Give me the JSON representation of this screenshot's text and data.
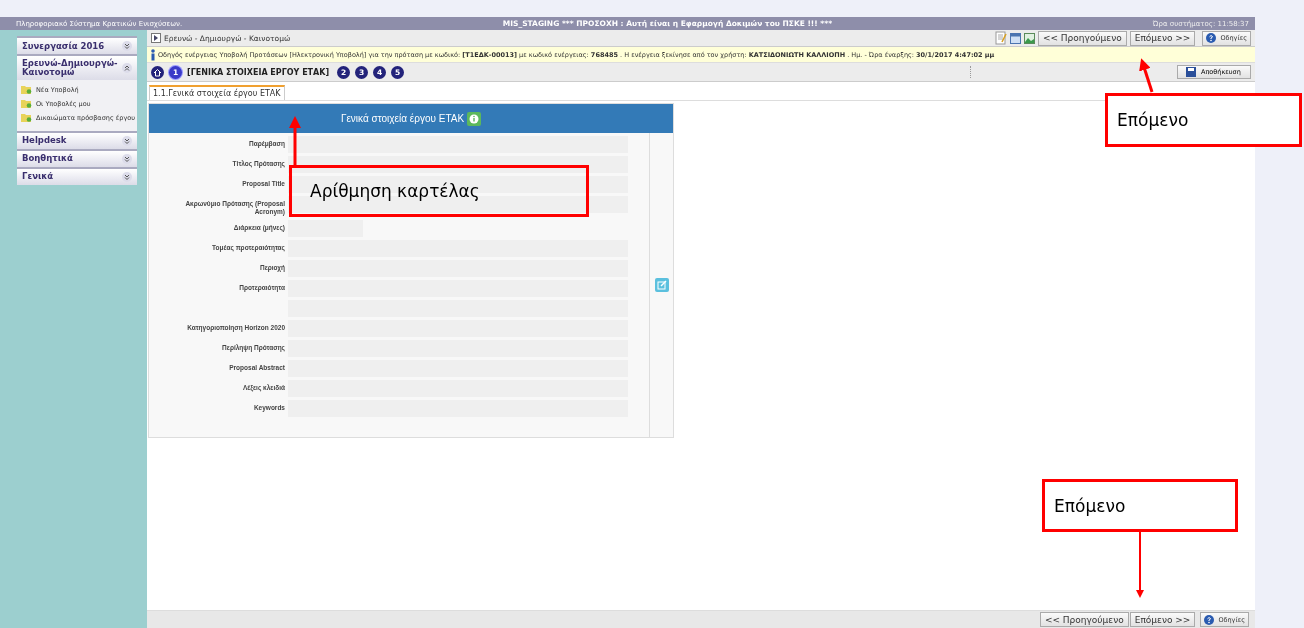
{
  "header": {
    "system": "Πληροφοριακό Σύστημα Κρατικών Ενισχύσεων.",
    "warning": "MIS_STAGING *** ΠΡΟΣΟΧΗ : Αυτή είναι η Εφαρμογή Δοκιμών του ΠΣΚΕ !!! ***",
    "clock": "Ώρα συστήματος: 11:58:37"
  },
  "sidebar": {
    "sections": [
      {
        "title": "Συνεργασία 2016",
        "expanded": false
      },
      {
        "title": "Ερευνώ-Δημιουργώ-Καινοτομώ",
        "expanded": true,
        "items": [
          "Νέα Υποβολή",
          "Οι Υποβολές μου",
          "Δικαιώματα πρόσβασης έργου"
        ]
      },
      {
        "title": "Helpdesk",
        "expanded": false
      },
      {
        "title": "Βοηθητικά",
        "expanded": false
      },
      {
        "title": "Γενικά",
        "expanded": false
      }
    ]
  },
  "toolbar": {
    "breadcrumb": "Ερευνώ - Δημιουργώ - Καινοτομώ",
    "previous": "<< Προηγούμενο",
    "next": "Επόμενο >>",
    "help": "Οδηγίες"
  },
  "info": "Οδηγός ενέργειας Υποβολή Προτάσεων [Ηλεκτρονική Υποβολή] για την πρόταση με κωδικό: **[Τ1ΕΔΚ-00013]** με κωδικό ενέργειας: **768485** . Η ενέργεια ξεκίνησε από τον χρήστη: **ΚΑΤΣΙΔΟΝΙΩΤΗ ΚΑΛΛΙΟΠΗ** . Ημ. - Ώρα έναρξης: **30/1/2017 4:47:02 μμ**",
  "steps": [
    {
      "number": "1",
      "label": "[ΓΕΝΙΚΑ ΣΤΟΙΧΕΙΑ ΕΡΓΟΥ ΕΤΑΚ]",
      "selected": true
    },
    {
      "number": "2",
      "selected": false
    },
    {
      "number": "3",
      "selected": false
    },
    {
      "number": "4",
      "selected": false
    },
    {
      "number": "5",
      "selected": false
    }
  ],
  "save": "Αποθήκευση",
  "tabs": [
    {
      "label": "1.1.Γενικά στοιχεία έργου ΕΤΑΚ",
      "selected": true
    }
  ],
  "panel": {
    "title": "Γενικά στοιχεία έργου ΕΤΑΚ",
    "fields": [
      {
        "label": "Παρέμβαση",
        "kind": "wide"
      },
      {
        "label": "Τίτλος Πρότασης",
        "kind": "wide"
      },
      {
        "label": "Proposal Title",
        "kind": "wide"
      },
      {
        "label": "Ακρωνύμιο Πρότασης (Proposal Acronym)",
        "kind": "wide"
      },
      {
        "label": "Διάρκεια (μήνες)",
        "kind": "short"
      },
      {
        "label": "Τομέας προτεραιότητας",
        "kind": "wide"
      },
      {
        "label": "Περιοχή",
        "kind": "wide"
      },
      {
        "label": "Προτεραιότητα",
        "kind": "wide"
      },
      {
        "kind": "wide"
      },
      {
        "label": "Κατηγοριοποίηση Horizon 2020",
        "kind": "wide"
      },
      {
        "label": "Περίληψη Πρότασης",
        "kind": "wide"
      },
      {
        "label": "Proposal Abstract",
        "kind": "wide"
      },
      {
        "label": "Λέξεις κλειδιά",
        "kind": "wide"
      },
      {
        "label": "Keywords",
        "kind": "wide"
      }
    ]
  },
  "bottom_bar": {
    "previous": "<< Προηγούμενο",
    "next": "Επόμενο >>",
    "help": "Οδηγίες"
  },
  "annotations": [
    {
      "text": "Επόμενο"
    },
    {
      "text": "Αρίθμηση καρτέλας"
    },
    {
      "text": "Επόμενο"
    }
  ]
}
